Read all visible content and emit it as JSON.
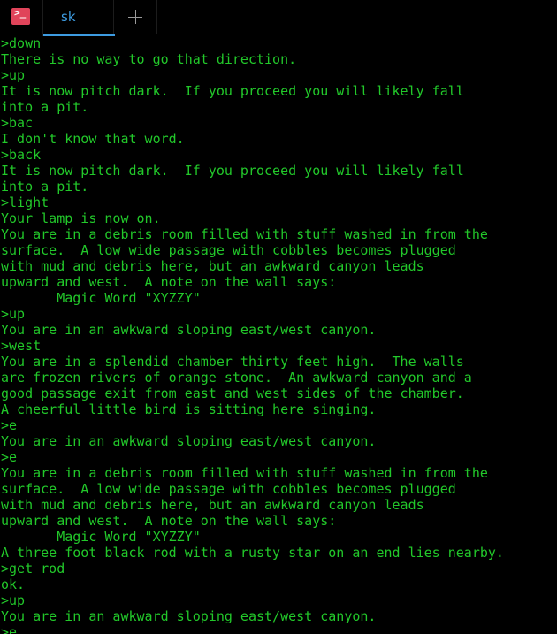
{
  "tabbar": {
    "app_icon": "terminal-icon",
    "app_icon_glyph": ">_",
    "tabs": [
      {
        "label": "sk",
        "active": true
      }
    ],
    "new_tab_icon": "plus-icon"
  },
  "colors": {
    "text": "#22c82a",
    "background": "#000000",
    "tab_accent": "#3d9be0",
    "icon_bg": "#e0445a"
  },
  "terminal": {
    "lines": [
      ">down",
      "There is no way to go that direction.",
      ">up",
      "It is now pitch dark.  If you proceed you will likely fall",
      "into a pit.",
      ">bac",
      "I don't know that word.",
      ">back",
      "It is now pitch dark.  If you proceed you will likely fall",
      "into a pit.",
      ">light",
      "Your lamp is now on.",
      "You are in a debris room filled with stuff washed in from the",
      "surface.  A low wide passage with cobbles becomes plugged",
      "with mud and debris here, but an awkward canyon leads",
      "upward and west.  A note on the wall says:",
      "       Magic Word \"XYZZY\"",
      ">up",
      "You are in an awkward sloping east/west canyon.",
      ">west",
      "You are in a splendid chamber thirty feet high.  The walls",
      "are frozen rivers of orange stone.  An awkward canyon and a",
      "good passage exit from east and west sides of the chamber.",
      "A cheerful little bird is sitting here singing.",
      ">e",
      "You are in an awkward sloping east/west canyon.",
      ">e",
      "You are in a debris room filled with stuff washed in from the",
      "surface.  A low wide passage with cobbles becomes plugged",
      "with mud and debris here, but an awkward canyon leads",
      "upward and west.  A note on the wall says:",
      "       Magic Word \"XYZZY\"",
      "A three foot black rod with a rusty star on an end lies nearby.",
      ">get rod",
      "ok.",
      ">up",
      "You are in an awkward sloping east/west canyon.",
      ">e"
    ]
  }
}
